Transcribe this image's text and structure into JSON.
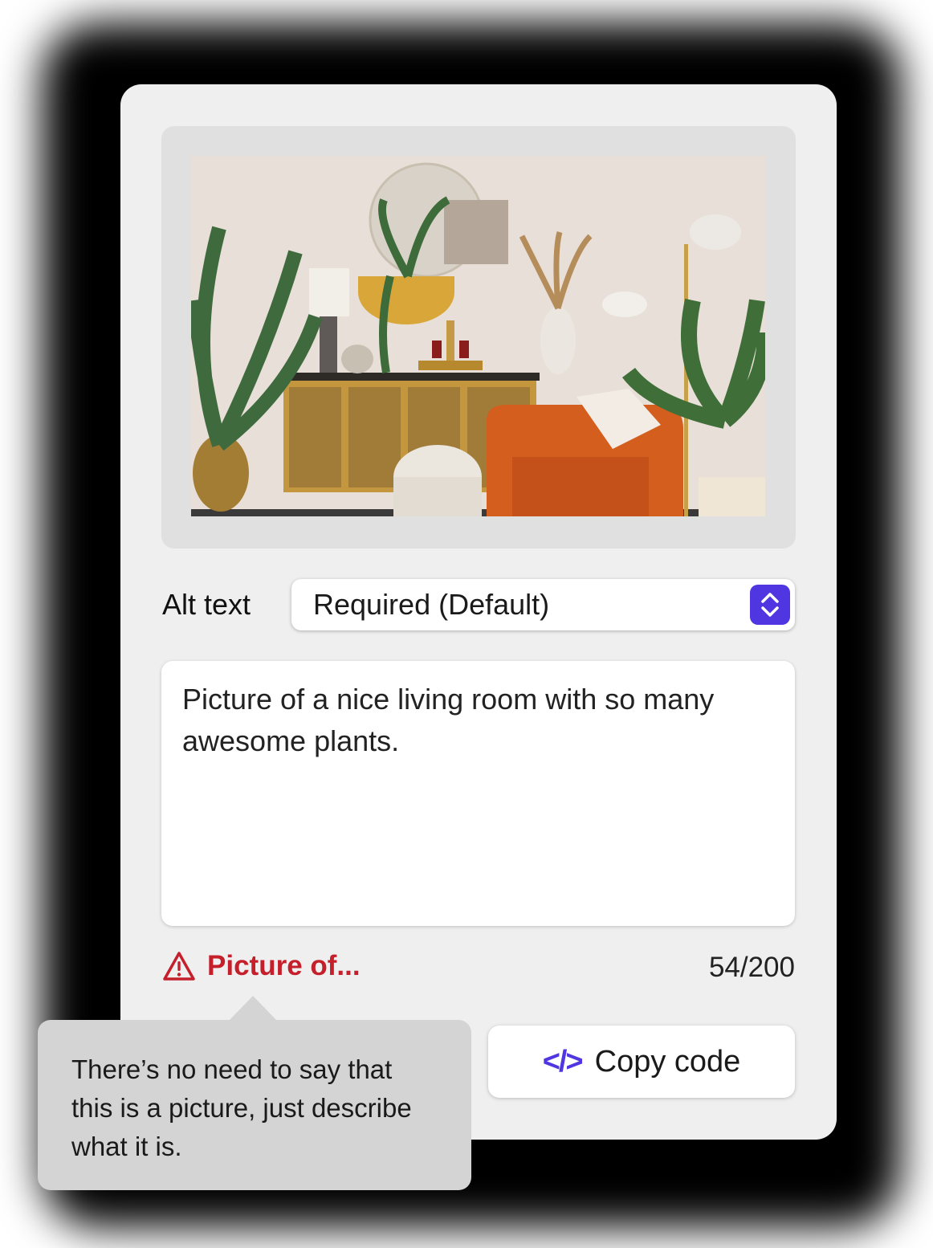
{
  "alt_text": {
    "label": "Alt text",
    "select_value": "Required (Default)",
    "text_value": "Picture of a nice living room with so many awesome plants."
  },
  "validation": {
    "warning": "Picture of...",
    "counter": "54/200",
    "tooltip": "There’s no need to say that this is a picture, just describe what it is."
  },
  "actions": {
    "copy_code_label": "Copy code"
  },
  "icons": {
    "stepper": "chevron-up-down-icon",
    "warning": "warning-triangle-icon",
    "copy": "code-icon"
  },
  "colors": {
    "accent": "#4f36e1",
    "warning": "#c41f2b",
    "panel": "#efefef"
  }
}
